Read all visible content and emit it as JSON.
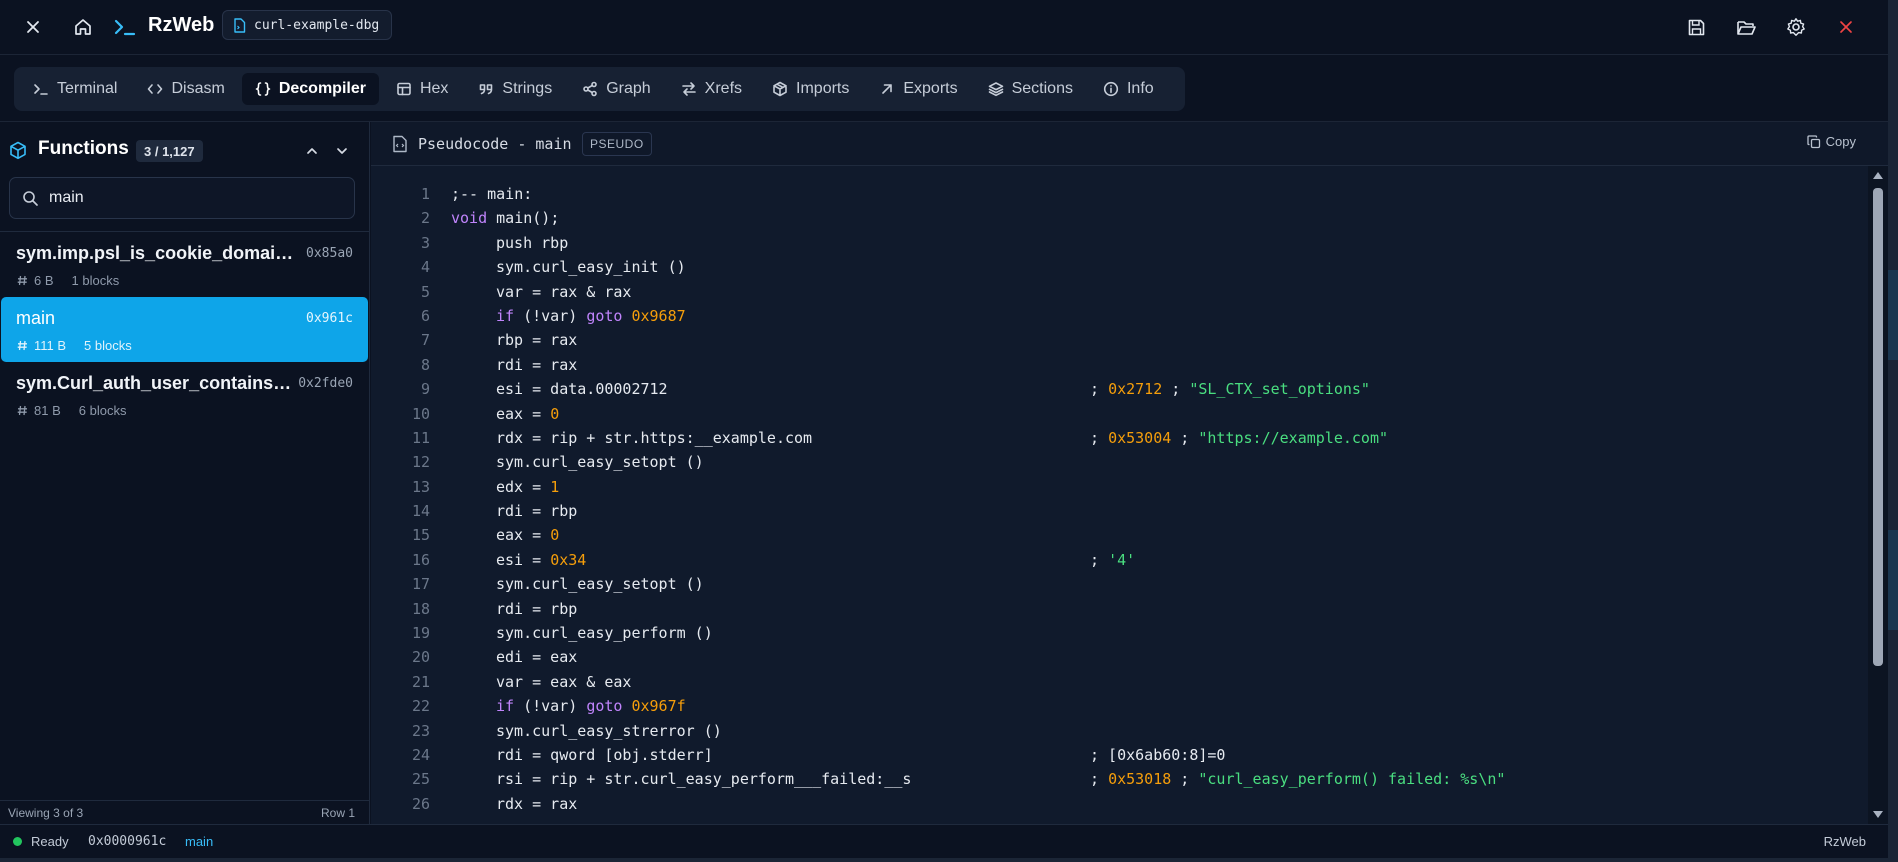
{
  "app": {
    "name": "RzWeb",
    "file": "curl-example-dbg"
  },
  "icons": {
    "close": "close-icon",
    "home": "home-icon",
    "prompt": "terminal-prompt-icon",
    "file": "file-icon",
    "save": "save-icon",
    "open": "folder-open-icon",
    "settings": "gear-icon",
    "quit": "close-icon"
  },
  "tabs": [
    {
      "id": "terminal",
      "label": "Terminal",
      "icon": "terminal-icon",
      "active": false
    },
    {
      "id": "disasm",
      "label": "Disasm",
      "icon": "code-brackets-icon",
      "active": false
    },
    {
      "id": "decompiler",
      "label": "Decompiler",
      "icon": "curly-braces-icon",
      "active": true
    },
    {
      "id": "hex",
      "label": "Hex",
      "icon": "table-icon",
      "active": false
    },
    {
      "id": "strings",
      "label": "Strings",
      "icon": "quote-icon",
      "active": false
    },
    {
      "id": "graph",
      "label": "Graph",
      "icon": "share-graph-icon",
      "active": false
    },
    {
      "id": "xrefs",
      "label": "Xrefs",
      "icon": "swap-arrows-icon",
      "active": false
    },
    {
      "id": "imports",
      "label": "Imports",
      "icon": "package-icon",
      "active": false
    },
    {
      "id": "exports",
      "label": "Exports",
      "icon": "arrow-up-right-icon",
      "active": false
    },
    {
      "id": "sections",
      "label": "Sections",
      "icon": "layers-icon",
      "active": false
    },
    {
      "id": "info",
      "label": "Info",
      "icon": "info-icon",
      "active": false
    }
  ],
  "functions": {
    "title": "Functions",
    "count": "3 / 1,127",
    "search": {
      "value": "main",
      "placeholder": ""
    },
    "items": [
      {
        "name": "sym.imp.psl_is_cookie_domain...",
        "addr": "0x85a0",
        "size": "6 B",
        "blocks": "1 blocks",
        "selected": false
      },
      {
        "name": "main",
        "addr": "0x961c",
        "size": "111 B",
        "blocks": "5 blocks",
        "selected": true
      },
      {
        "name": "sym.Curl_auth_user_contains_...",
        "addr": "0x2fde0",
        "size": "81 B",
        "blocks": "6 blocks",
        "selected": false
      }
    ],
    "footer": {
      "viewing": "Viewing 3 of 3",
      "row": "Row 1"
    }
  },
  "code": {
    "title": "Pseudocode - main",
    "badge": "PSEUDO",
    "copy_label": "Copy",
    "lines": [
      {
        "n": "1",
        "indent": 0,
        "parts": [
          {
            "t": ";-- main:"
          }
        ]
      },
      {
        "n": "2",
        "indent": 0,
        "parts": [
          {
            "t": "void",
            "c": "kw"
          },
          {
            "t": " main();"
          }
        ]
      },
      {
        "n": "3",
        "indent": 1,
        "parts": [
          {
            "t": "push rbp"
          }
        ]
      },
      {
        "n": "4",
        "indent": 1,
        "parts": [
          {
            "t": "sym.curl_easy_init ()"
          }
        ]
      },
      {
        "n": "5",
        "indent": 1,
        "parts": [
          {
            "t": "var = rax & rax"
          }
        ]
      },
      {
        "n": "6",
        "indent": 1,
        "parts": [
          {
            "t": "if",
            "c": "kw"
          },
          {
            "t": " (!var) "
          },
          {
            "t": "goto",
            "c": "kw"
          },
          {
            "t": " "
          },
          {
            "t": "0x9687",
            "c": "num"
          }
        ]
      },
      {
        "n": "7",
        "indent": 1,
        "parts": [
          {
            "t": "rbp = rax"
          }
        ]
      },
      {
        "n": "8",
        "indent": 1,
        "parts": [
          {
            "t": "rdi = rax"
          }
        ]
      },
      {
        "n": "9",
        "indent": 1,
        "parts": [
          {
            "t": "esi = data.00002712"
          }
        ],
        "comment": [
          {
            "t": "; "
          },
          {
            "t": "0x2712",
            "c": "num"
          },
          {
            "t": " ; "
          },
          {
            "t": "\"SL_CTX_set_options\"",
            "c": "str"
          }
        ]
      },
      {
        "n": "10",
        "indent": 1,
        "parts": [
          {
            "t": "eax = "
          },
          {
            "t": "0",
            "c": "num"
          }
        ]
      },
      {
        "n": "11",
        "indent": 1,
        "parts": [
          {
            "t": "rdx = rip + str.https:__example.com"
          }
        ],
        "comment": [
          {
            "t": "; "
          },
          {
            "t": "0x53004",
            "c": "num"
          },
          {
            "t": " ; "
          },
          {
            "t": "\"https://example.com\"",
            "c": "str"
          }
        ]
      },
      {
        "n": "12",
        "indent": 1,
        "parts": [
          {
            "t": "sym.curl_easy_setopt ()"
          }
        ]
      },
      {
        "n": "13",
        "indent": 1,
        "parts": [
          {
            "t": "edx = "
          },
          {
            "t": "1",
            "c": "num"
          }
        ]
      },
      {
        "n": "14",
        "indent": 1,
        "parts": [
          {
            "t": "rdi = rbp"
          }
        ]
      },
      {
        "n": "15",
        "indent": 1,
        "parts": [
          {
            "t": "eax = "
          },
          {
            "t": "0",
            "c": "num"
          }
        ]
      },
      {
        "n": "16",
        "indent": 1,
        "parts": [
          {
            "t": "esi = "
          },
          {
            "t": "0x34",
            "c": "num"
          }
        ],
        "comment": [
          {
            "t": "; "
          },
          {
            "t": "'4'",
            "c": "str"
          }
        ]
      },
      {
        "n": "17",
        "indent": 1,
        "parts": [
          {
            "t": "sym.curl_easy_setopt ()"
          }
        ]
      },
      {
        "n": "18",
        "indent": 1,
        "parts": [
          {
            "t": "rdi = rbp"
          }
        ]
      },
      {
        "n": "19",
        "indent": 1,
        "parts": [
          {
            "t": "sym.curl_easy_perform ()"
          }
        ]
      },
      {
        "n": "20",
        "indent": 1,
        "parts": [
          {
            "t": "edi = eax"
          }
        ]
      },
      {
        "n": "21",
        "indent": 1,
        "parts": [
          {
            "t": "var = eax & eax"
          }
        ]
      },
      {
        "n": "22",
        "indent": 1,
        "parts": [
          {
            "t": "if",
            "c": "kw"
          },
          {
            "t": " (!var) "
          },
          {
            "t": "goto",
            "c": "kw"
          },
          {
            "t": " "
          },
          {
            "t": "0x967f",
            "c": "num"
          }
        ]
      },
      {
        "n": "23",
        "indent": 1,
        "parts": [
          {
            "t": "sym.curl_easy_strerror ()"
          }
        ]
      },
      {
        "n": "24",
        "indent": 1,
        "parts": [
          {
            "t": "rdi = qword [obj.stderr]"
          }
        ],
        "comment": [
          {
            "t": "; [0x6ab60:8]=0"
          }
        ]
      },
      {
        "n": "25",
        "indent": 1,
        "parts": [
          {
            "t": "rsi = rip + str.curl_easy_perform___failed:__s"
          }
        ],
        "comment": [
          {
            "t": "; "
          },
          {
            "t": "0x53018",
            "c": "num"
          },
          {
            "t": " ; "
          },
          {
            "t": "\"curl_easy_perform() failed: %s\\n\"",
            "c": "str"
          }
        ]
      },
      {
        "n": "26",
        "indent": 1,
        "parts": [
          {
            "t": "rdx = rax"
          }
        ]
      }
    ]
  },
  "status": {
    "state": "Ready",
    "address": "0x0000961c",
    "function": "main",
    "brand": "RzWeb"
  },
  "colors": {
    "accent": "#0ea5e9",
    "keyword": "#c084fc",
    "number": "#f59e0b",
    "string": "#4ade80",
    "ready": "#22c55e"
  }
}
